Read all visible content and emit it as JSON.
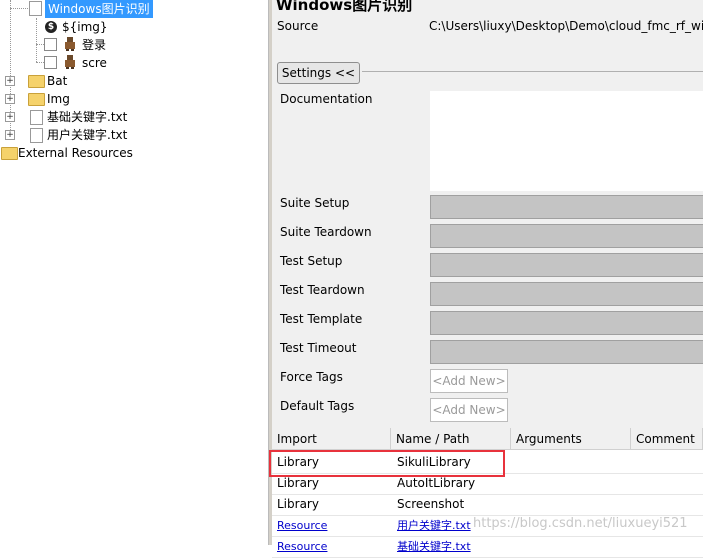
{
  "tree": {
    "selected_label": "Windows图片识别",
    "items": [
      {
        "label": "${img}"
      },
      {
        "label": "登录"
      },
      {
        "label": "scre"
      },
      {
        "label": "Bat"
      },
      {
        "label": "Img"
      },
      {
        "label": "基础关键字.txt"
      },
      {
        "label": "用户关键字.txt"
      },
      {
        "label": "External Resources"
      }
    ]
  },
  "panel": {
    "title": "Windows图片识别",
    "source_label": "Source",
    "source_path": "C:\\Users\\liuxy\\Desktop\\Demo\\cloud_fmc_rf_windo",
    "settings_button": "Settings <<",
    "documentation_label": "Documentation",
    "settings_rows": [
      {
        "label": "Suite Setup"
      },
      {
        "label": "Suite Teardown"
      },
      {
        "label": "Test Setup"
      },
      {
        "label": "Test Teardown"
      },
      {
        "label": "Test Template"
      },
      {
        "label": "Test Timeout"
      }
    ],
    "force_tags_label": "Force Tags",
    "default_tags_label": "Default Tags",
    "add_new_placeholder": "<Add New>"
  },
  "imports": {
    "headers": [
      "Import",
      "Name / Path",
      "Arguments",
      "Comment"
    ],
    "rows": [
      {
        "type": "Library",
        "name": "SikuliLibrary",
        "highlighted": true
      },
      {
        "type": "Library",
        "name": "AutoItLibrary"
      },
      {
        "type": "Library",
        "name": "Screenshot"
      },
      {
        "type": "Resource",
        "name": "用户关键字.txt",
        "link": true
      },
      {
        "type": "Resource",
        "name": "基础关键字.txt",
        "link": true
      }
    ]
  },
  "watermark": "https://blog.csdn.net/liuxueyi521",
  "colors": {
    "selection": "#3399ff",
    "highlight_box": "#e8323c",
    "field_gray": "#c4c4c4",
    "link": "#0000cc"
  }
}
